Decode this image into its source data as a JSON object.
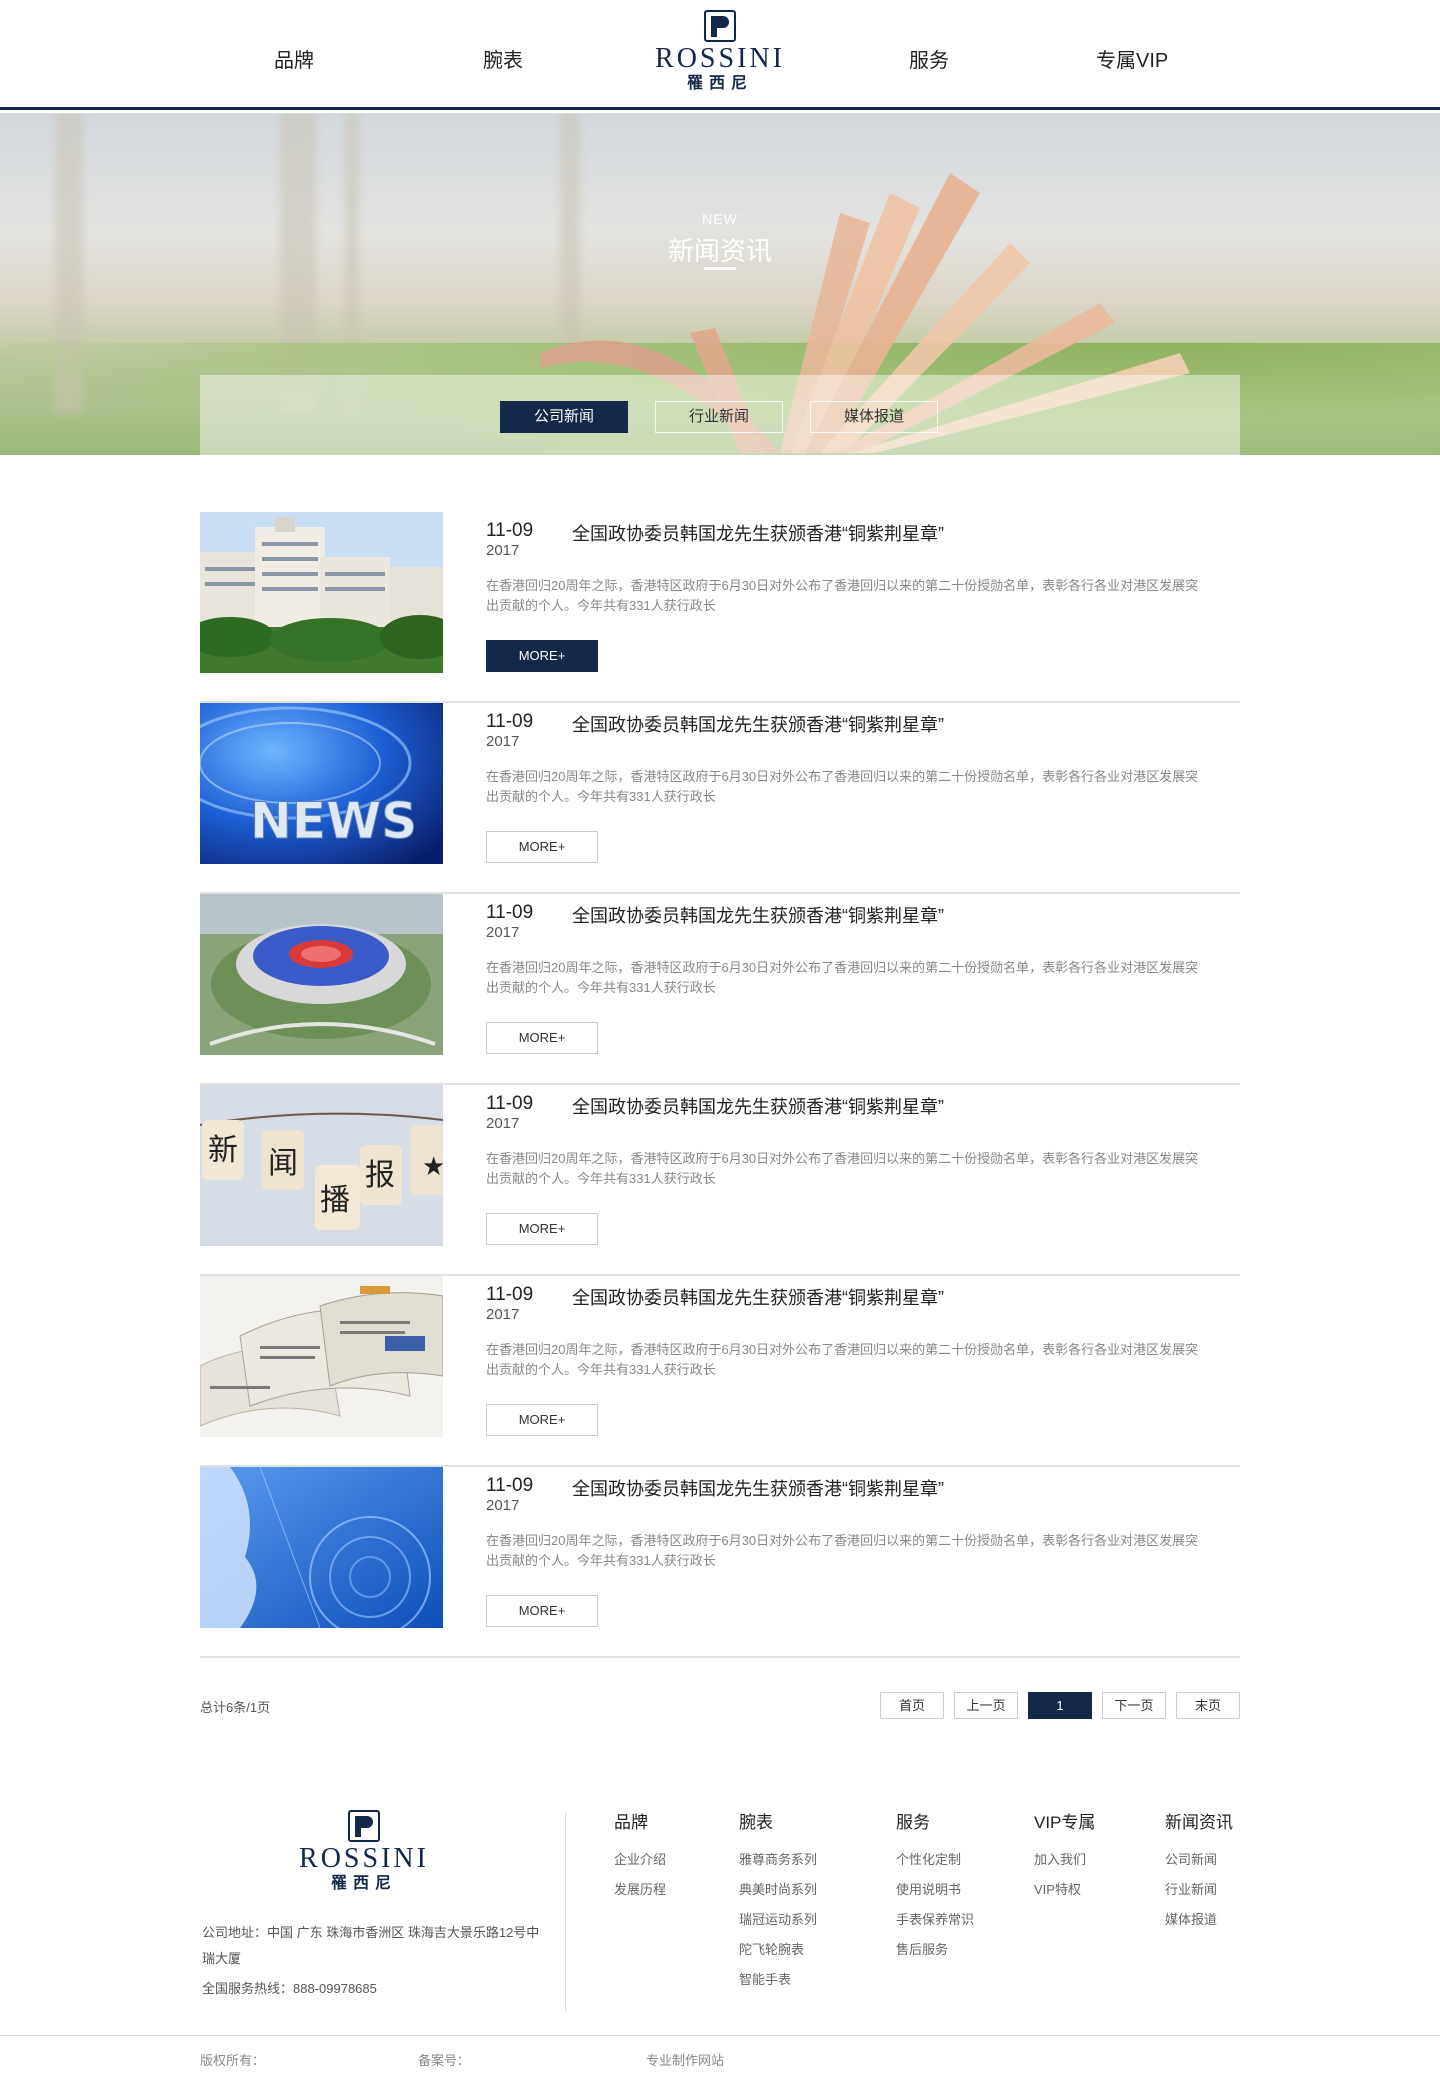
{
  "nav": {
    "left": [
      "品牌",
      "腕表"
    ],
    "right": [
      "服务",
      "专属VIP"
    ]
  },
  "logo": {
    "text": "ROSSINI",
    "cn": "罹西尼"
  },
  "banner": {
    "subtitle": "NEW",
    "title": "新闻资讯",
    "tabs": [
      "公司新闻",
      "行业新闻",
      "媒体报道"
    ],
    "active_tab": 0
  },
  "news": [
    {
      "date": "11-09",
      "year": "2017",
      "title": "全国政协委员韩国龙先生获颁香港“铜紫荆星章”",
      "desc": "在香港回归20周年之际，香港特区政府于6月30日对外公布了香港回归以来的第二十份授勋名单，表彰各行各业对港区发展突出贡献的个人。今年共有331人获行政长",
      "more": "MORE+",
      "image": "building"
    },
    {
      "date": "11-09",
      "year": "2017",
      "title": "全国政协委员韩国龙先生获颁香港“铜紫荆星章”",
      "desc": "在香港回归20周年之际，香港特区政府于6月30日对外公布了香港回归以来的第二十份授勋名单，表彰各行各业对港区发展突出贡献的个人。今年共有331人获行政长",
      "more": "MORE+",
      "image": "news-globe",
      "image_text": "NEWS"
    },
    {
      "date": "11-09",
      "year": "2017",
      "title": "全国政协委员韩国龙先生获颁香港“铜紫荆星章”",
      "desc": "在香港回归20周年之际，香港特区政府于6月30日对外公布了香港回归以来的第二十份授勋名单，表彰各行各业对港区发展突出贡献的个人。今年共有331人获行政长",
      "more": "MORE+",
      "image": "stadium"
    },
    {
      "date": "11-09",
      "year": "2017",
      "title": "全国政协委员韩国龙先生获颁香港“铜紫荆星章”",
      "desc": "在香港回归20周年之际，香港特区政府于6月30日对外公布了香港回归以来的第二十份授勋名单，表彰各行各业对港区发展突出贡献的个人。今年共有331人获行政长",
      "more": "MORE+",
      "image": "tags",
      "image_text": [
        "新",
        "闻",
        "播",
        "报"
      ]
    },
    {
      "date": "11-09",
      "year": "2017",
      "title": "全国政协委员韩国龙先生获颁香港“铜紫荆星章”",
      "desc": "在香港回归20周年之际，香港特区政府于6月30日对外公布了香港回归以来的第二十份授勋名单，表彰各行各业对港区发展突出贡献的个人。今年共有331人获行政长",
      "more": "MORE+",
      "image": "newspapers"
    },
    {
      "date": "11-09",
      "year": "2017",
      "title": "全国政协委员韩国龙先生获颁香港“铜紫荆星章”",
      "desc": "在香港回归20周年之际，香港特区政府于6月30日对外公布了香港回归以来的第二十份授勋名单，表彰各行各业对港区发展突出贡献的个人。今年共有331人获行政长",
      "more": "MORE+",
      "image": "blue-map"
    }
  ],
  "pagination": {
    "total": "总计6条/1页",
    "buttons": [
      "首页",
      "上一页",
      "1",
      "下一页",
      "末页"
    ],
    "active": 2
  },
  "footer": {
    "address": "公司地址：中国 广东 珠海市香洲区 珠海吉大景乐路12号中瑞大厦",
    "hotline": "全国服务热线：888-09978685",
    "columns": [
      {
        "title": "品牌",
        "items": [
          "企业介绍",
          "发展历程"
        ]
      },
      {
        "title": "腕表",
        "items": [
          "雅尊商务系列",
          "典美时尚系列",
          "瑞冠运动系列",
          "陀飞轮腕表",
          "智能手表"
        ]
      },
      {
        "title": "服务",
        "items": [
          "个性化定制",
          "使用说明书",
          "手表保养常识",
          "售后服务"
        ]
      },
      {
        "title": "VIP专属",
        "items": [
          "加入我们",
          "VIP特权"
        ]
      },
      {
        "title": "新闻资讯",
        "items": [
          "公司新闻",
          "行业新闻",
          "媒体报道"
        ]
      }
    ],
    "copyright": "版权所有：",
    "icp": "备案号：",
    "made_by": "专业制作网站"
  },
  "colors": {
    "primary": "#14284a",
    "divider": "#e2e2e2"
  }
}
